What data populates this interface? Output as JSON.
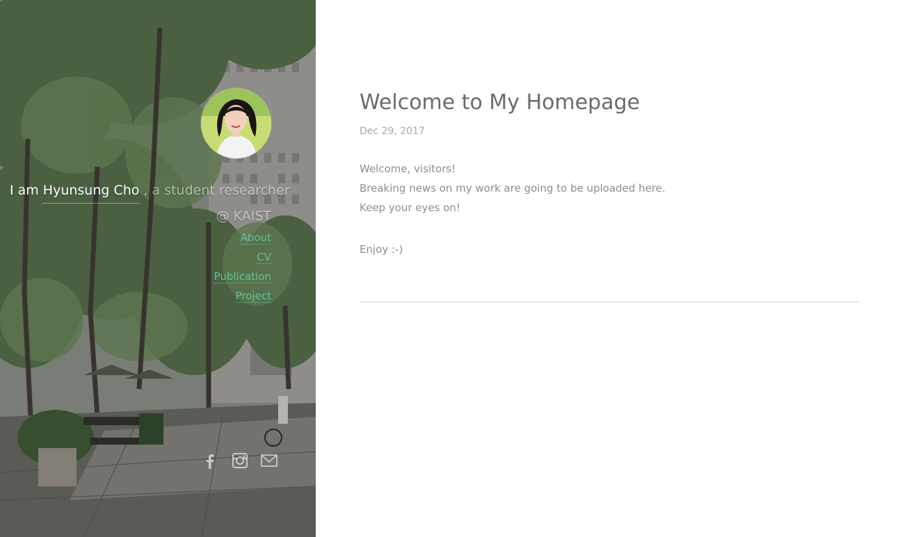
{
  "sidebar": {
    "intro": {
      "lead": "I am",
      "name": "Hyunsung Cho",
      "role": ", a student researcher",
      "affiliation": "@ KAIST"
    },
    "nav": [
      {
        "label": "About"
      },
      {
        "label": "CV"
      },
      {
        "label": "Publication"
      },
      {
        "label": "Project"
      }
    ],
    "social": [
      {
        "icon": "facebook-icon"
      },
      {
        "icon": "instagram-icon"
      },
      {
        "icon": "mail-icon"
      }
    ],
    "colors": {
      "link": "#5fc39d"
    }
  },
  "post": {
    "title": "Welcome to My Homepage",
    "date": "Dec 29, 2017",
    "lines": [
      "Welcome, visitors!",
      "Breaking news on my work are going to be uploaded here.",
      "Keep your eyes on!"
    ],
    "closing": "Enjoy :-)"
  }
}
